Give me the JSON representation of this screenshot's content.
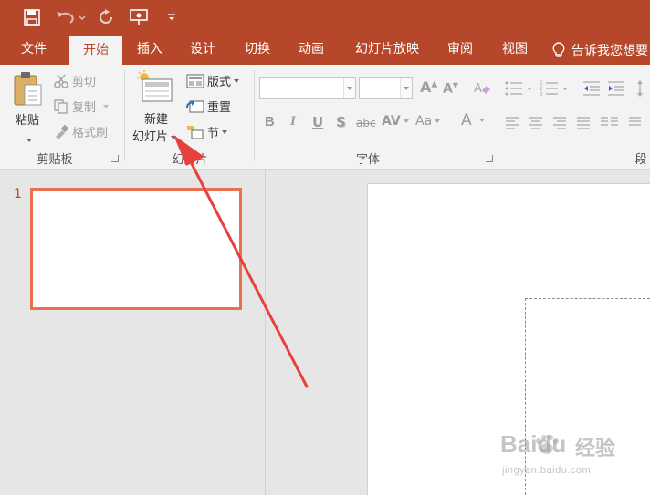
{
  "quick_access": {
    "save_icon": "save-icon",
    "undo_icon": "undo-icon",
    "redo_icon": "redo-icon",
    "present_icon": "present-from-start-icon",
    "customize_icon": "customize-toolbar-icon"
  },
  "tabs": [
    {
      "label": "文件"
    },
    {
      "label": "开始"
    },
    {
      "label": "插入"
    },
    {
      "label": "设计"
    },
    {
      "label": "切换"
    },
    {
      "label": "动画"
    },
    {
      "label": "幻灯片放映"
    },
    {
      "label": "审阅"
    },
    {
      "label": "视图"
    }
  ],
  "active_tab": "开始",
  "tell_me": "告诉我您想要",
  "ribbon": {
    "clipboard": {
      "paste": "粘贴",
      "cut": "剪切",
      "copy": "复制",
      "format_painter": "格式刷",
      "group_label": "剪贴板"
    },
    "slides": {
      "new_slide_line1": "新建",
      "new_slide_line2": "幻灯片",
      "layout": "版式",
      "reset": "重置",
      "section": "节",
      "group_label": "幻灯片"
    },
    "font": {
      "font_name": "",
      "font_size": "",
      "group_label": "字体",
      "bold": "B",
      "italic": "I",
      "underline": "U",
      "shadow": "S",
      "strike": "abc",
      "spacing": "AV",
      "case": "Aa",
      "color": "A",
      "grow": "A",
      "shrink": "A"
    },
    "paragraph": {
      "group_label": "段"
    }
  },
  "slides_pane": {
    "slide_number": "1"
  },
  "watermark": {
    "brand": "Baidu",
    "brand_cn": "经验",
    "url": "jingyan.baidu.com"
  },
  "colors": {
    "accent": "#b7472a",
    "thumb_border": "#e9704f",
    "arrow": "#e8403c"
  }
}
